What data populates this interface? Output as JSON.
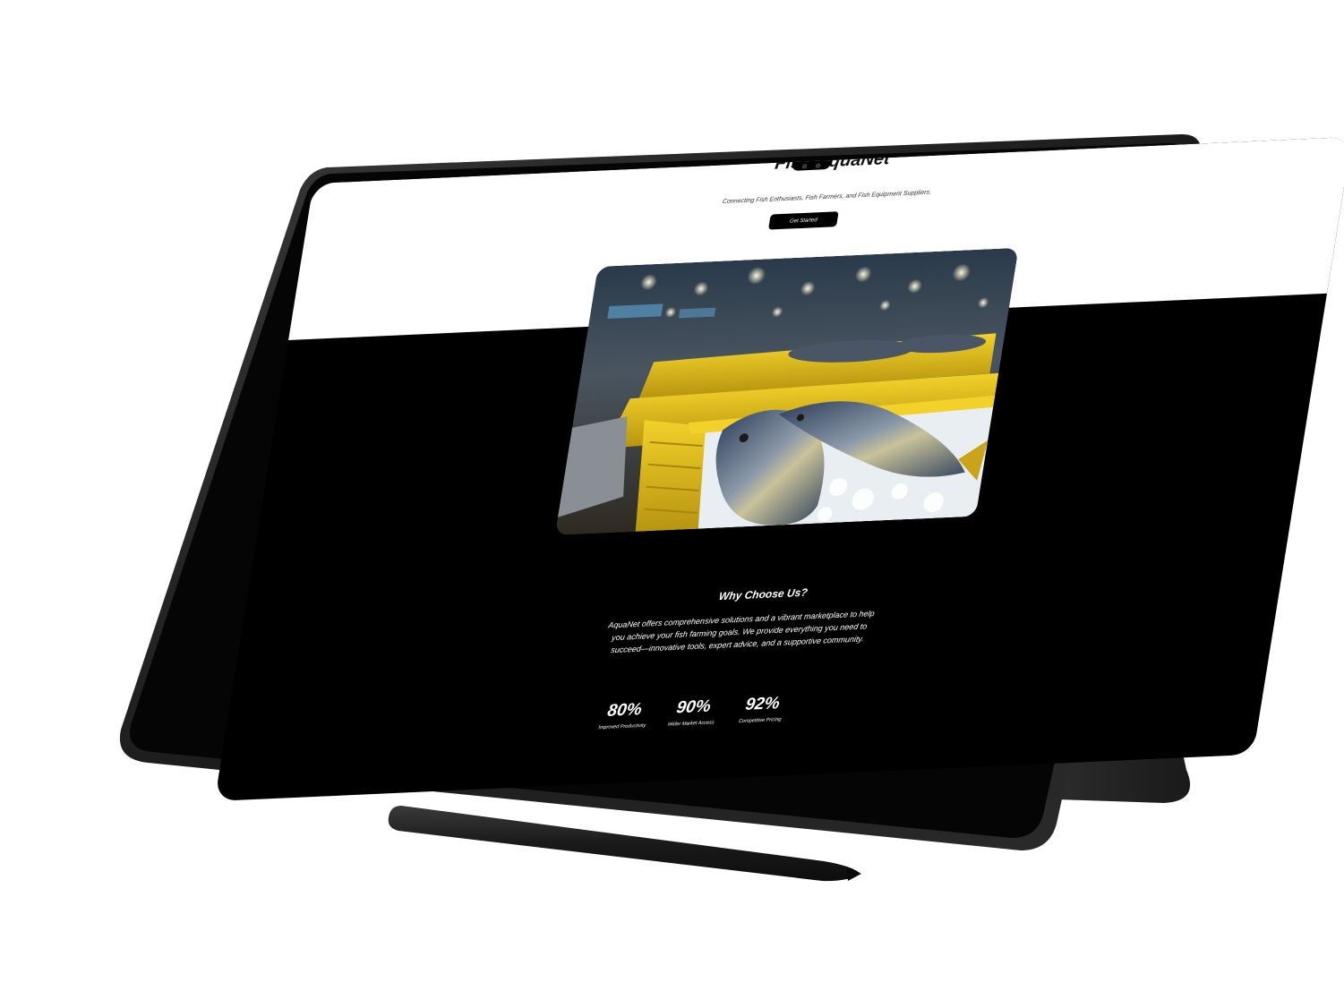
{
  "site": {
    "title": "Fish AquaNet",
    "tagline": "Connecting Fish Enthusiasts, Fish Farmers, and Fish Equipment Suppliers.",
    "cta_label": "Get Started"
  },
  "why": {
    "title": "Why Choose Us?",
    "text": "AquaNet offers comprehensive solutions and a vibrant marketplace to help you achieve your fish farming goals. We provide everything you need to succeed—innovative tools, expert advice, and a supportive community."
  },
  "stats": [
    {
      "value": "80%",
      "label": "Improved Productivity"
    },
    {
      "value": "90%",
      "label": "Wider Market Access"
    },
    {
      "value": "92%",
      "label": "Competitive Pricing"
    }
  ],
  "icons": {
    "hero": "fish-market-photo",
    "stylus": "stylus-pen",
    "camera": "front-camera"
  },
  "colors": {
    "screen_bg": "#000000",
    "top_band": "#ffffff",
    "device_frame": "#1c1c1c",
    "accent_yellow": "#e6c21a"
  }
}
